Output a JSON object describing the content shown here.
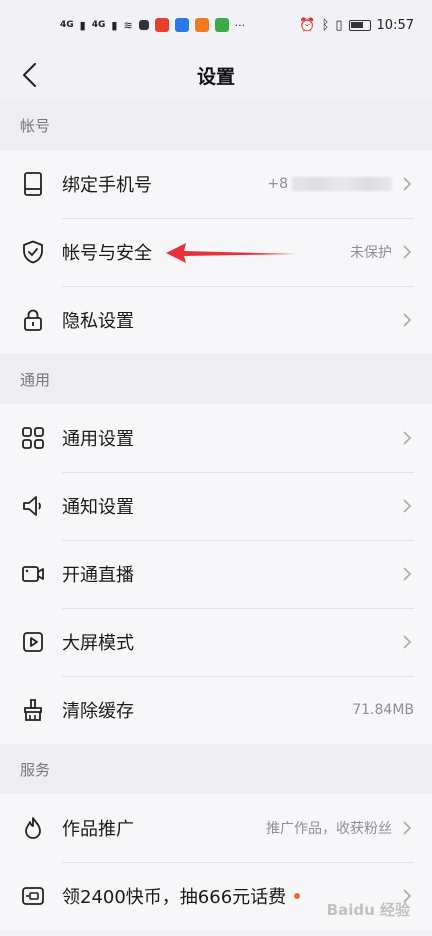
{
  "status_bar": {
    "signal1": "4G",
    "signal2": "4G",
    "time": "10:57"
  },
  "nav": {
    "title": "设置"
  },
  "sections": [
    {
      "header": "帐号",
      "items": [
        {
          "label": "绑定手机号",
          "value": "+8",
          "icon": "phone-icon"
        },
        {
          "label": "帐号与安全",
          "value": "未保护",
          "icon": "shield-check-icon"
        },
        {
          "label": "隐私设置",
          "value": "",
          "icon": "lock-icon"
        }
      ]
    },
    {
      "header": "通用",
      "items": [
        {
          "label": "通用设置",
          "value": "",
          "icon": "grid-icon"
        },
        {
          "label": "通知设置",
          "value": "",
          "icon": "speaker-icon"
        },
        {
          "label": "开通直播",
          "value": "",
          "icon": "video-camera-icon"
        },
        {
          "label": "大屏模式",
          "value": "",
          "icon": "play-screen-icon"
        },
        {
          "label": "清除缓存",
          "value": "71.84MB",
          "icon": "broom-icon"
        }
      ]
    },
    {
      "header": "服务",
      "items": [
        {
          "label": "作品推广",
          "value": "推广作品，收获粉丝",
          "icon": "flame-icon"
        },
        {
          "label": "领2400快币，抽666元话费",
          "value": "",
          "icon": "coin-card-icon"
        }
      ]
    }
  ],
  "watermark": "Baidu 经验",
  "colors": {
    "background": "#f2f1f5",
    "annotation_arrow": "#e8323a",
    "badge_dot": "#f06a28"
  }
}
